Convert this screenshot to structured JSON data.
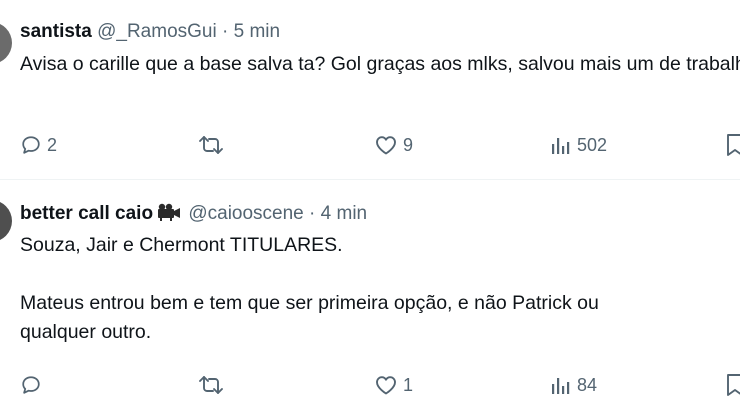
{
  "tweets": [
    {
      "display_name": "santista",
      "handle": "@_RamosGui",
      "separator": "·",
      "time": "5 min",
      "text": "Avisa o carille que a base salva ta? Gol graças aos mlks, salvou mais um\nde trabalho",
      "replies": "2",
      "retweets": "",
      "likes": "9",
      "views": "502"
    },
    {
      "display_name": "better call caio",
      "badge_icon": "projector-icon",
      "handle": "@caiooscene",
      "separator": "·",
      "time": "4 min",
      "text": "Souza, Jair e Chermont TITULARES.\n\nMateus entrou bem e tem que ser primeira opção, e não Patrick ou\nqualquer outro.",
      "replies": "",
      "retweets": "",
      "likes": "1",
      "views": "84"
    }
  ],
  "colors": {
    "text": "#0f1419",
    "secondary": "#536471",
    "divider": "#eff3f4"
  }
}
